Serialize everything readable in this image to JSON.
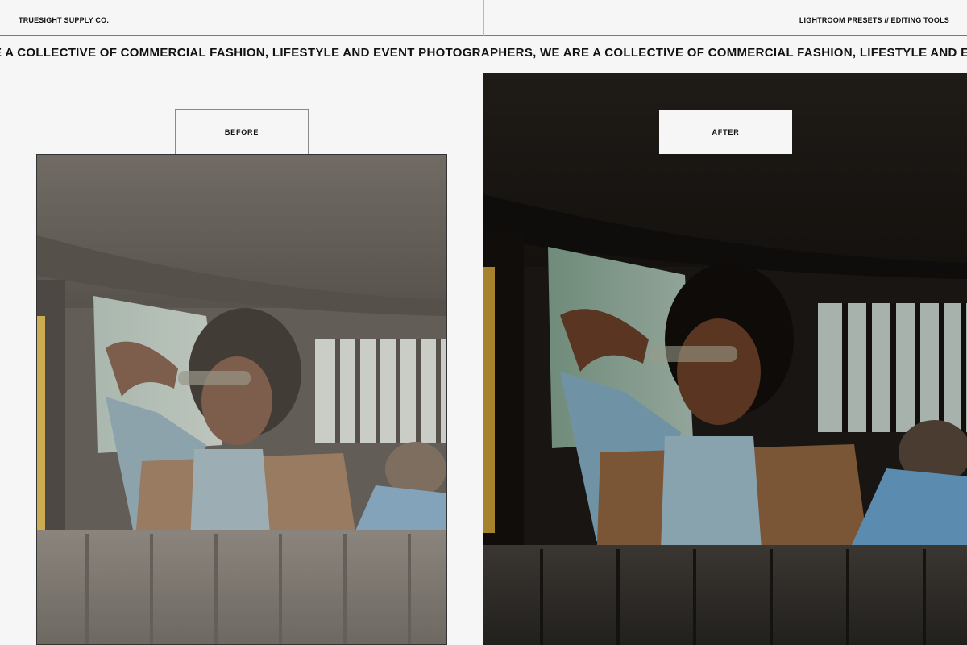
{
  "header": {
    "brand": "TRUESIGHT SUPPLY CO.",
    "tagline": "LIGHTROOM PRESETS // EDITING TOOLS"
  },
  "marquee": {
    "text": "E A COLLECTIVE OF COMMERCIAL FASHION, LIFESTYLE AND EVENT PHOTOGRAPHERS, WE ARE A COLLECTIVE OF COMMERCIAL FASHION, LIFESTYLE AND EVENT PHOTOGRA"
  },
  "comparison": {
    "before_label": "BEFORE",
    "after_label": "AFTER"
  }
}
